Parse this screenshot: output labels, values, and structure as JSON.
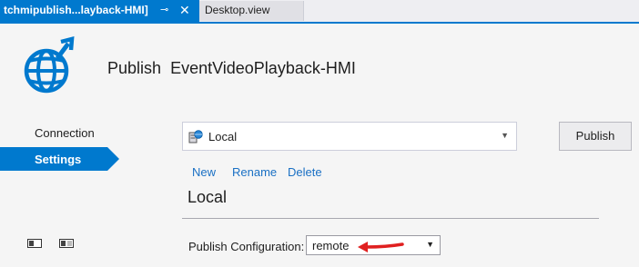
{
  "tabs": [
    {
      "title": "tchmipublish...layback-HMI]",
      "pin_icon": "⊸",
      "close_icon": "✕"
    },
    {
      "title": "Desktop.view"
    }
  ],
  "header": {
    "prefix": "Publish",
    "project": "EventVideoPlayback-HMI"
  },
  "sidebar": {
    "items": [
      {
        "label": "Connection",
        "active": false
      },
      {
        "label": "Settings",
        "active": true
      }
    ]
  },
  "profile": {
    "selected": "Local",
    "icon": "server-globe-icon"
  },
  "publish_button": "Publish",
  "actions": [
    "New",
    "Rename",
    "Delete"
  ],
  "section": {
    "title": "Local"
  },
  "config": {
    "label": "Publish Configuration:",
    "value": "remote"
  },
  "colors": {
    "accent": "#0079ce",
    "link": "#1a70c4",
    "annotation_arrow": "#e02020"
  }
}
